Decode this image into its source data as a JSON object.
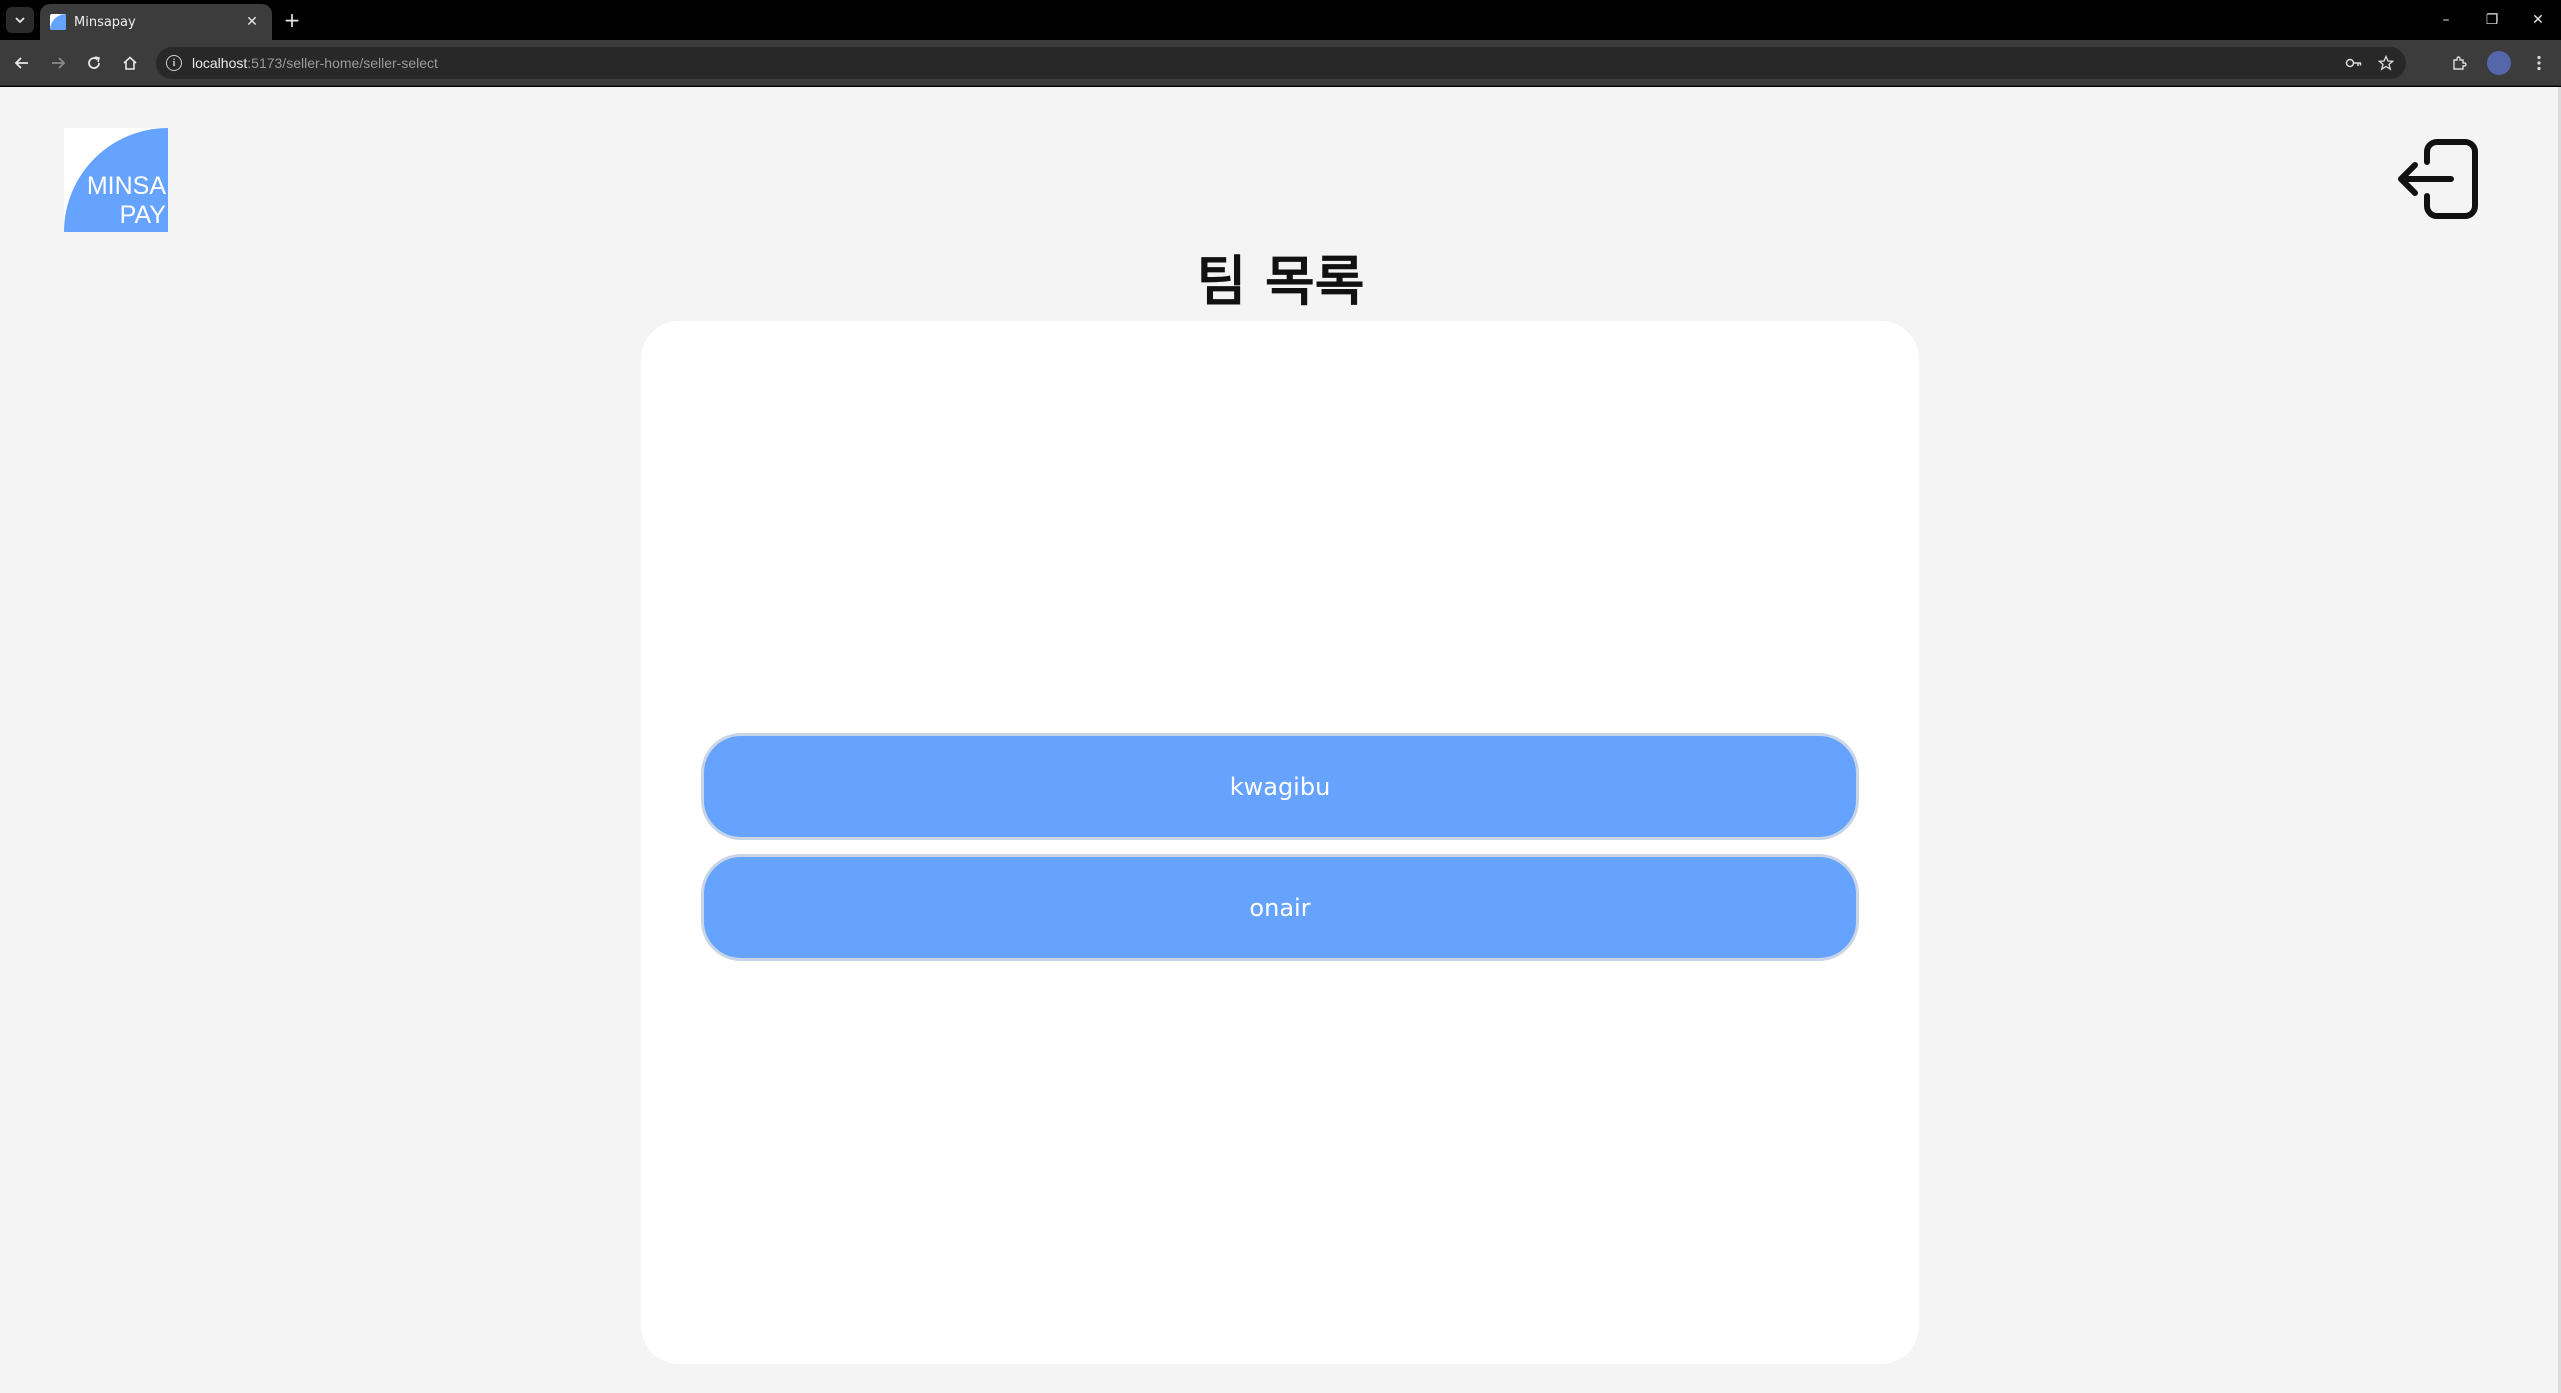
{
  "browser": {
    "tab_title": "Minsapay",
    "tab_list_icon": "chevron-down-icon",
    "tab_close_glyph": "✕",
    "new_tab_glyph": "+",
    "url_host": "localhost",
    "url_path": ":5173/seller-home/seller-select",
    "window_controls": [
      "–",
      "❐",
      "✕"
    ]
  },
  "app": {
    "logo_line1": "MINSA",
    "logo_line2": "PAY",
    "page_title": "팀 목록",
    "teams": [
      {
        "label": "kwagibu"
      },
      {
        "label": "onair"
      }
    ]
  },
  "colors": {
    "accent": "#66a3ff",
    "page_bg": "#f4f4f4",
    "card_bg": "#ffffff",
    "button_border": "#c9d5e6"
  }
}
